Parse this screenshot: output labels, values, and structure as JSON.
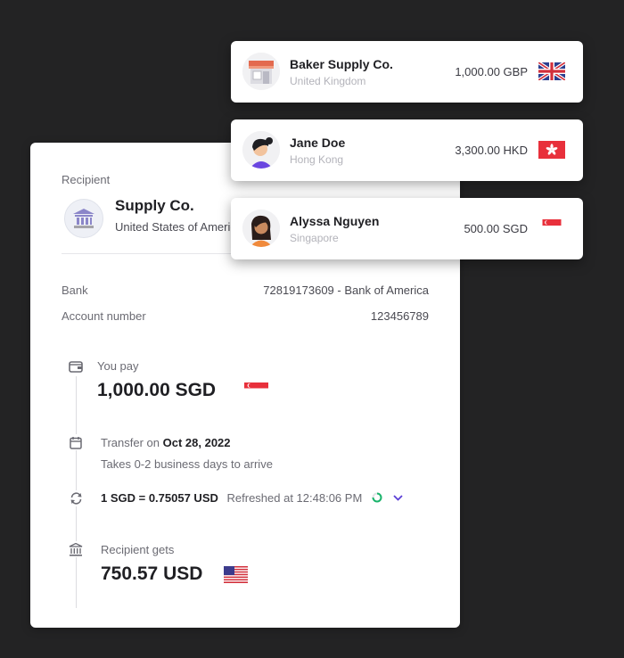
{
  "transfer_card": {
    "recipient_label": "Recipient",
    "recipient_name": "Supply Co.",
    "recipient_country": "United States of America",
    "bank_label": "Bank",
    "bank_value": "72819173609 - Bank of America",
    "account_label": "Account number",
    "account_value": "123456789",
    "you_pay_label": "You pay",
    "you_pay_amount": "1,000.00 SGD",
    "transfer_on_label": "Transfer on",
    "transfer_date": "Oct 28, 2022",
    "transfer_note": "Takes 0-2 business days to arrive",
    "rate_text": "1 SGD = 0.75057 USD",
    "refreshed_text": "Refreshed at 12:48:06 PM",
    "recipient_gets_label": "Recipient gets",
    "recipient_gets_amount": "750.57 USD"
  },
  "payees": [
    {
      "name": "Baker Supply Co.",
      "country": "United Kingdom",
      "amount": "1,000.00 GBP",
      "flag": "uk-flag-icon",
      "avatar": "shop-icon"
    },
    {
      "name": "Jane Doe",
      "country": "Hong Kong",
      "amount": "3,300.00 HKD",
      "flag": "hong-kong-flag-icon",
      "avatar": "woman-avatar"
    },
    {
      "name": "Alyssa Nguyen",
      "country": "Singapore",
      "amount": "500.00 SGD",
      "flag": "singapore-flag-icon",
      "avatar": "woman-avatar"
    }
  ],
  "colors": {
    "background": "#232324",
    "card": "#ffffff",
    "accent_purple": "#5b3fd6",
    "refresh_green": "#19b46b"
  }
}
